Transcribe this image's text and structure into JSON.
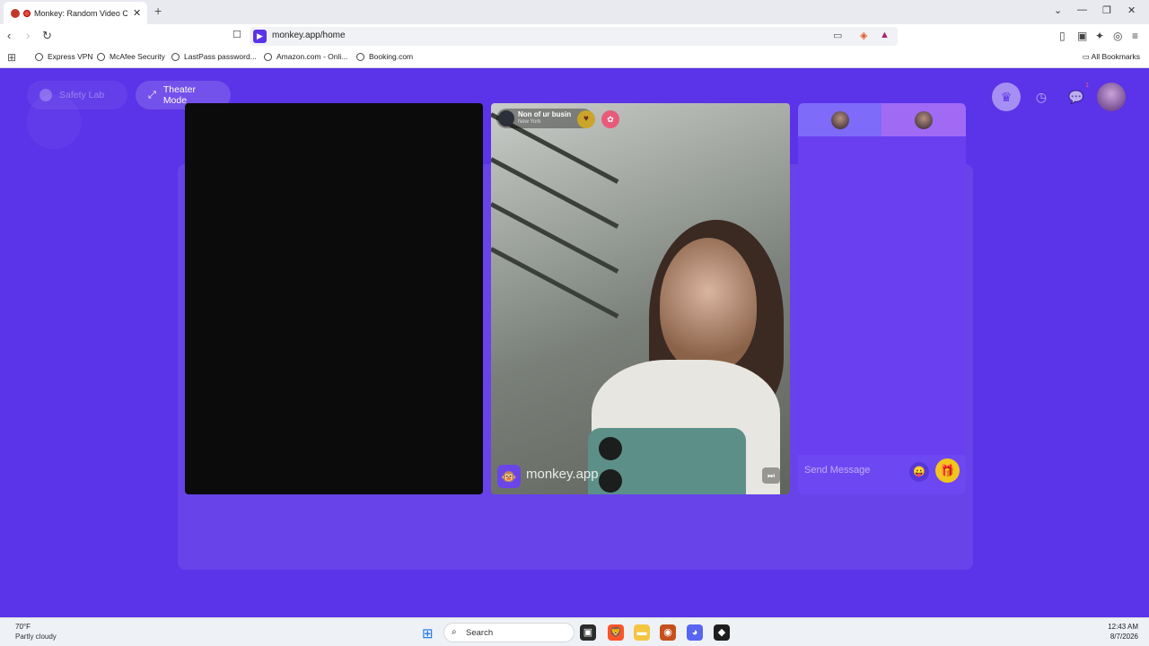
{
  "browser": {
    "tab_title": "Monkey: Random Video Chat",
    "tab_close": "✕",
    "new_tab": "+",
    "url": "monkey.app/home",
    "window_controls": [
      "⌄",
      "—",
      "❐",
      "✕"
    ],
    "bookmarks": [
      "Express VPN",
      "McAfee Security",
      "LastPass password...",
      "Amazon.com - Onli...",
      "Booking.com"
    ],
    "all_bookmarks": "All Bookmarks"
  },
  "app": {
    "safety_lab": "Safety Lab",
    "theater_mode": "Theater Mode",
    "chat_badge": "1",
    "peer": {
      "name": "Non of ur busin",
      "location": "New York"
    },
    "watermark": "monkey.app",
    "chat_placeholder": "Send Message"
  },
  "taskbar": {
    "temperature": "70°F",
    "weather": "Partly cloudy",
    "search": "Search",
    "time": "12:43 AM",
    "date": "8/7/2026"
  },
  "colors": {
    "brand": "#5b33e8",
    "panel": "#6a3ff0",
    "gift": "#f3c51c"
  }
}
